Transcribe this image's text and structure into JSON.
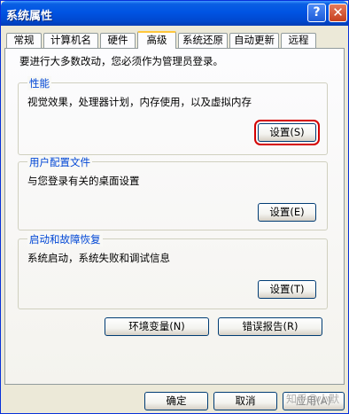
{
  "window": {
    "title": "系统属性",
    "help_label": "?",
    "close_label": "✕"
  },
  "tabs": [
    {
      "label": "常规"
    },
    {
      "label": "计算机名"
    },
    {
      "label": "硬件"
    },
    {
      "label": "高级"
    },
    {
      "label": "系统还原"
    },
    {
      "label": "自动更新"
    },
    {
      "label": "远程"
    }
  ],
  "active_tab": "高级",
  "intro_text": "要进行大多数改动，您必须作为管理员登录。",
  "groups": {
    "performance": {
      "title": "性能",
      "description": "视觉效果，处理器计划，内存使用，以及虚拟内存",
      "button_label": "设置(S)"
    },
    "user_profiles": {
      "title": "用户配置文件",
      "description": "与您登录有关的桌面设置",
      "button_label": "设置(E)"
    },
    "startup_recovery": {
      "title": "启动和故障恢复",
      "description": "系统启动，系统失败和调试信息",
      "button_label": "设置(T)"
    }
  },
  "env_button_label": "环境变量(N)",
  "error_report_button_label": "错误报告(R)",
  "footer": {
    "ok_label": "确定",
    "cancel_label": "取消",
    "apply_label": "应用(A)"
  },
  "watermark": "知乎@小默",
  "colors": {
    "titlebar": "#0054e3",
    "group_title": "#0046d5",
    "focus_highlight": "#d40000",
    "active_tab_accent": "#ffc73c"
  }
}
